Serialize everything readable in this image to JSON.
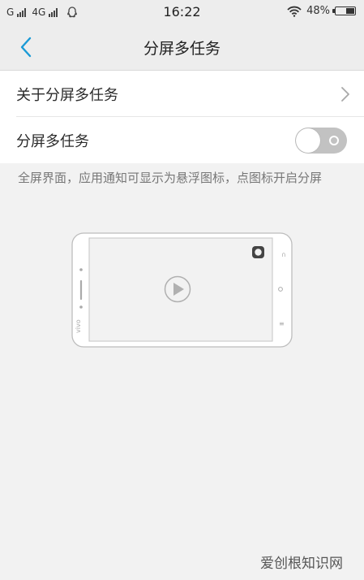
{
  "status_bar": {
    "sim1_label": "G",
    "sim2_label": "4G",
    "time": "16:22",
    "battery_percent": "48%",
    "battery_level": 0.48
  },
  "navbar": {
    "title": "分屏多任务"
  },
  "settings": {
    "about_label": "关于分屏多任务",
    "toggle_label": "分屏多任务",
    "toggle_on": false
  },
  "description": "全屏界面，应用通知可显示为悬浮图标，点图标开启分屏",
  "watermark": "爱创根知识网",
  "icons": {
    "back": "chevron-left-icon",
    "about_arrow": "chevron-right-icon",
    "notification": "qq-penguin-icon",
    "wifi": "wifi-icon",
    "battery": "battery-icon",
    "play": "play-icon",
    "floating": "floating-bubble-icon"
  },
  "colors": {
    "accent": "#1a9ad6",
    "toggle_off": "#c2c2c2",
    "background": "#f2f2f2"
  }
}
